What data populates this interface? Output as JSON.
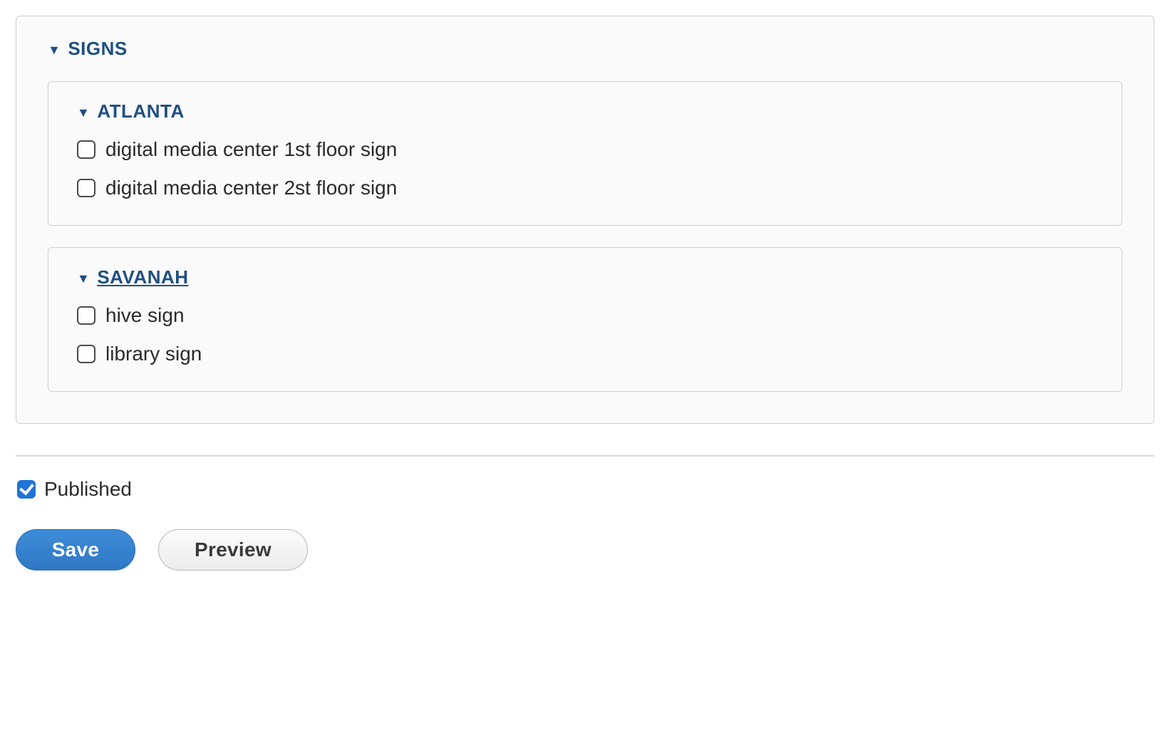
{
  "signs": {
    "header": "SIGNS",
    "groups": [
      {
        "header": "ATLANTA",
        "underlined": false,
        "items": [
          {
            "label": "digital media center 1st floor sign",
            "checked": false
          },
          {
            "label": "digital media center 2st floor sign",
            "checked": false
          }
        ]
      },
      {
        "header": "SAVANAH",
        "underlined": true,
        "items": [
          {
            "label": "hive sign",
            "checked": false
          },
          {
            "label": "library sign",
            "checked": false
          }
        ]
      }
    ]
  },
  "published": {
    "label": "Published",
    "checked": true
  },
  "buttons": {
    "save": "Save",
    "preview": "Preview"
  }
}
